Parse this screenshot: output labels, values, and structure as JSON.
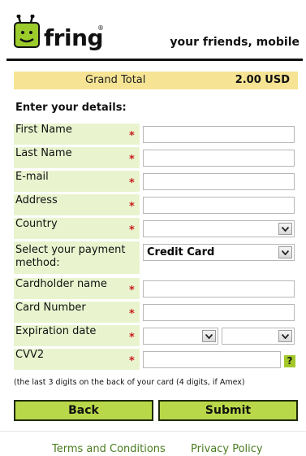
{
  "header": {
    "brand": "fring",
    "registered": "®",
    "tagline": "your friends, mobile"
  },
  "total": {
    "label": "Grand Total",
    "value": "2.00 USD"
  },
  "section_title": "Enter your details:",
  "required_marker": "*",
  "fields": [
    {
      "label": "First Name",
      "value": ""
    },
    {
      "label": "Last Name",
      "value": ""
    },
    {
      "label": "E-mail",
      "value": ""
    },
    {
      "label": "Address",
      "value": ""
    },
    {
      "label": "Country",
      "value": ""
    },
    {
      "label": "Select your payment method:",
      "value": "Credit Card"
    },
    {
      "label": "Cardholder name",
      "value": ""
    },
    {
      "label": "Card Number",
      "value": ""
    },
    {
      "label": "Expiration date",
      "value": ""
    },
    {
      "label": "CVV2",
      "value": ""
    }
  ],
  "help_symbol": "?",
  "cvv_hint": "(the last 3 digits on the back of your card (4 digits, if Amex)",
  "buttons": {
    "back": "Back",
    "submit": "Submit"
  },
  "footer": {
    "terms": "Terms and Conditions",
    "privacy": "Privacy Policy"
  },
  "colors": {
    "label_bg": "#e9f4cf",
    "total_bg": "#f6e494",
    "button_bg": "#b8d84a",
    "link": "#4a7d1f",
    "required": "#c81d1d"
  },
  "icons": [
    "fring-logo-icon",
    "chevron-down-icon",
    "help-icon"
  ]
}
